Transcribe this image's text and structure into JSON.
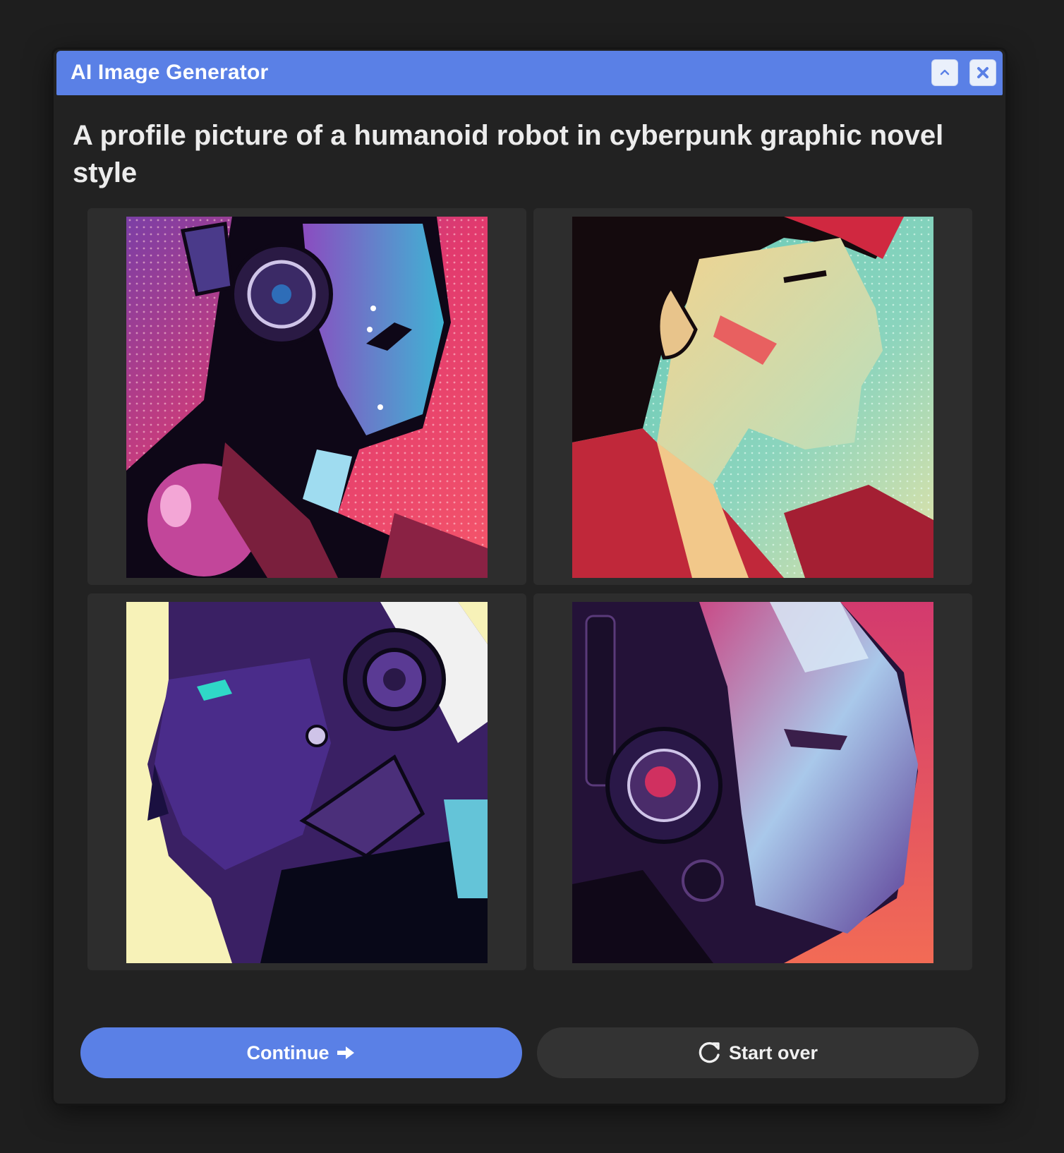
{
  "window": {
    "title": "AI Image Generator",
    "controls": [
      "collapse-icon",
      "close-icon"
    ],
    "accent_color": "#5a80e6"
  },
  "prompt": "A profile picture of a humanoid robot in cyberpunk graphic novel style",
  "images": [
    {
      "description_icon": "robot-portrait-pink-blue"
    },
    {
      "description_icon": "portrait-red-hair-teal-background"
    },
    {
      "description_icon": "robot-portrait-purple-yellow"
    },
    {
      "description_icon": "robot-portrait-headphones-pink"
    }
  ],
  "actions": {
    "continue_label": "Continue",
    "continue_icon": "arrow-right-icon",
    "start_over_label": "Start over",
    "start_over_icon": "refresh-icon"
  }
}
